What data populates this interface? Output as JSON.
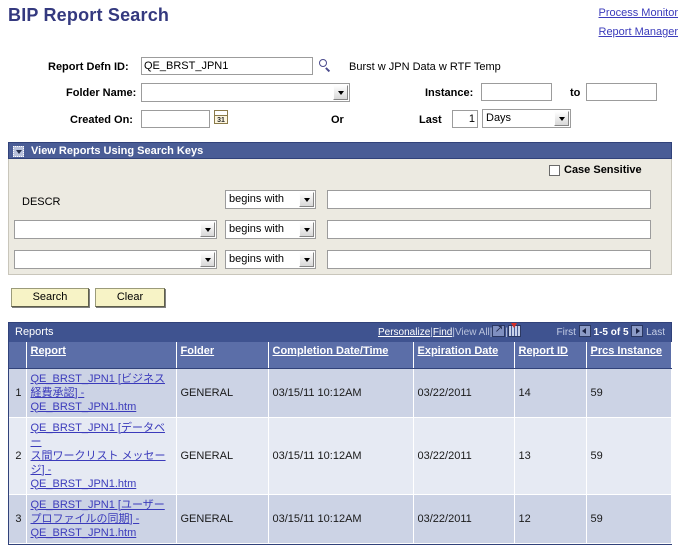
{
  "page": {
    "title": "BIP Report Search"
  },
  "top_links": [
    {
      "label": "Process Monitor",
      "name": "process-monitor-link"
    },
    {
      "label": "Report Manager",
      "name": "report-manager-link"
    }
  ],
  "criteria": {
    "report_defn_id": {
      "label": "Report Defn ID:",
      "value": "QE_BRST_JPN1",
      "lookup_icon": "search-magnifier-icon",
      "description": "Burst w JPN Data w RTF Temp"
    },
    "folder_name": {
      "label": "Folder Name:",
      "value": ""
    },
    "created_on": {
      "label": "Created On:",
      "value": "",
      "calendar_icon": "calendar-icon",
      "calendar_day": "31"
    },
    "or_label": "Or",
    "instance": {
      "label": "Instance:",
      "from_value": "",
      "to_label": "to",
      "to_value": ""
    },
    "last": {
      "label": "Last",
      "value": "1",
      "unit": "Days"
    }
  },
  "search_keys": {
    "section_title": "View Reports Using Search Keys",
    "case_sensitive_label": "Case Sensitive",
    "case_sensitive_checked": false,
    "rows": [
      {
        "field": "DESCR",
        "field_is_dropdown": false,
        "operator": "begins with",
        "value": ""
      },
      {
        "field": "",
        "field_is_dropdown": true,
        "operator": "begins with",
        "value": ""
      },
      {
        "field": "",
        "field_is_dropdown": true,
        "operator": "begins with",
        "value": ""
      }
    ]
  },
  "buttons": {
    "search": "Search",
    "clear": "Clear"
  },
  "grid": {
    "title": "Reports",
    "actions": {
      "personalize": "Personalize",
      "find": "Find",
      "view_all": "View All",
      "expand_icon": "expand-grid-icon",
      "download_icon": "download-to-spreadsheet-icon",
      "sep": "|"
    },
    "nav": {
      "first": "First",
      "prev_icon": "previous-page-arrow-icon",
      "range": "1-5 of 5",
      "next_icon": "next-page-arrow-icon",
      "last": "Last"
    },
    "columns": [
      "Report",
      "Folder",
      "Completion Date/Time",
      "Expiration Date",
      "Report ID",
      "Prcs Instance"
    ],
    "rows": [
      {
        "num": "1",
        "report_line1": "QE_BRST_JPN1 [ビジネス",
        "report_line2": "経費承認] -",
        "report_line3": "QE_BRST_JPN1.htm",
        "folder": "GENERAL",
        "completion": "03/15/11 10:12AM",
        "expiration": "03/22/2011",
        "report_id": "14",
        "prcs_instance": "59"
      },
      {
        "num": "2",
        "report_line1": "QE_BRST_JPN1 [データベー",
        "report_line2": "ス間ワークリスト メッセージ] -",
        "report_line3": "QE_BRST_JPN1.htm",
        "folder": "GENERAL",
        "completion": "03/15/11 10:12AM",
        "expiration": "03/22/2011",
        "report_id": "13",
        "prcs_instance": "59"
      },
      {
        "num": "3",
        "report_line1": "QE_BRST_JPN1 [ユーザー",
        "report_line2": "プロファイルの同期] -",
        "report_line3": "QE_BRST_JPN1.htm",
        "folder": "GENERAL",
        "completion": "03/15/11 10:12AM",
        "expiration": "03/22/2011",
        "report_id": "12",
        "prcs_instance": "59"
      }
    ]
  },
  "colors": {
    "title": "#34397f",
    "header_bar": "#4a5d96",
    "grid_header": "#3f5390",
    "link": "#3b3bbb",
    "button": "#f7f3c6",
    "panel": "#eceae1"
  }
}
